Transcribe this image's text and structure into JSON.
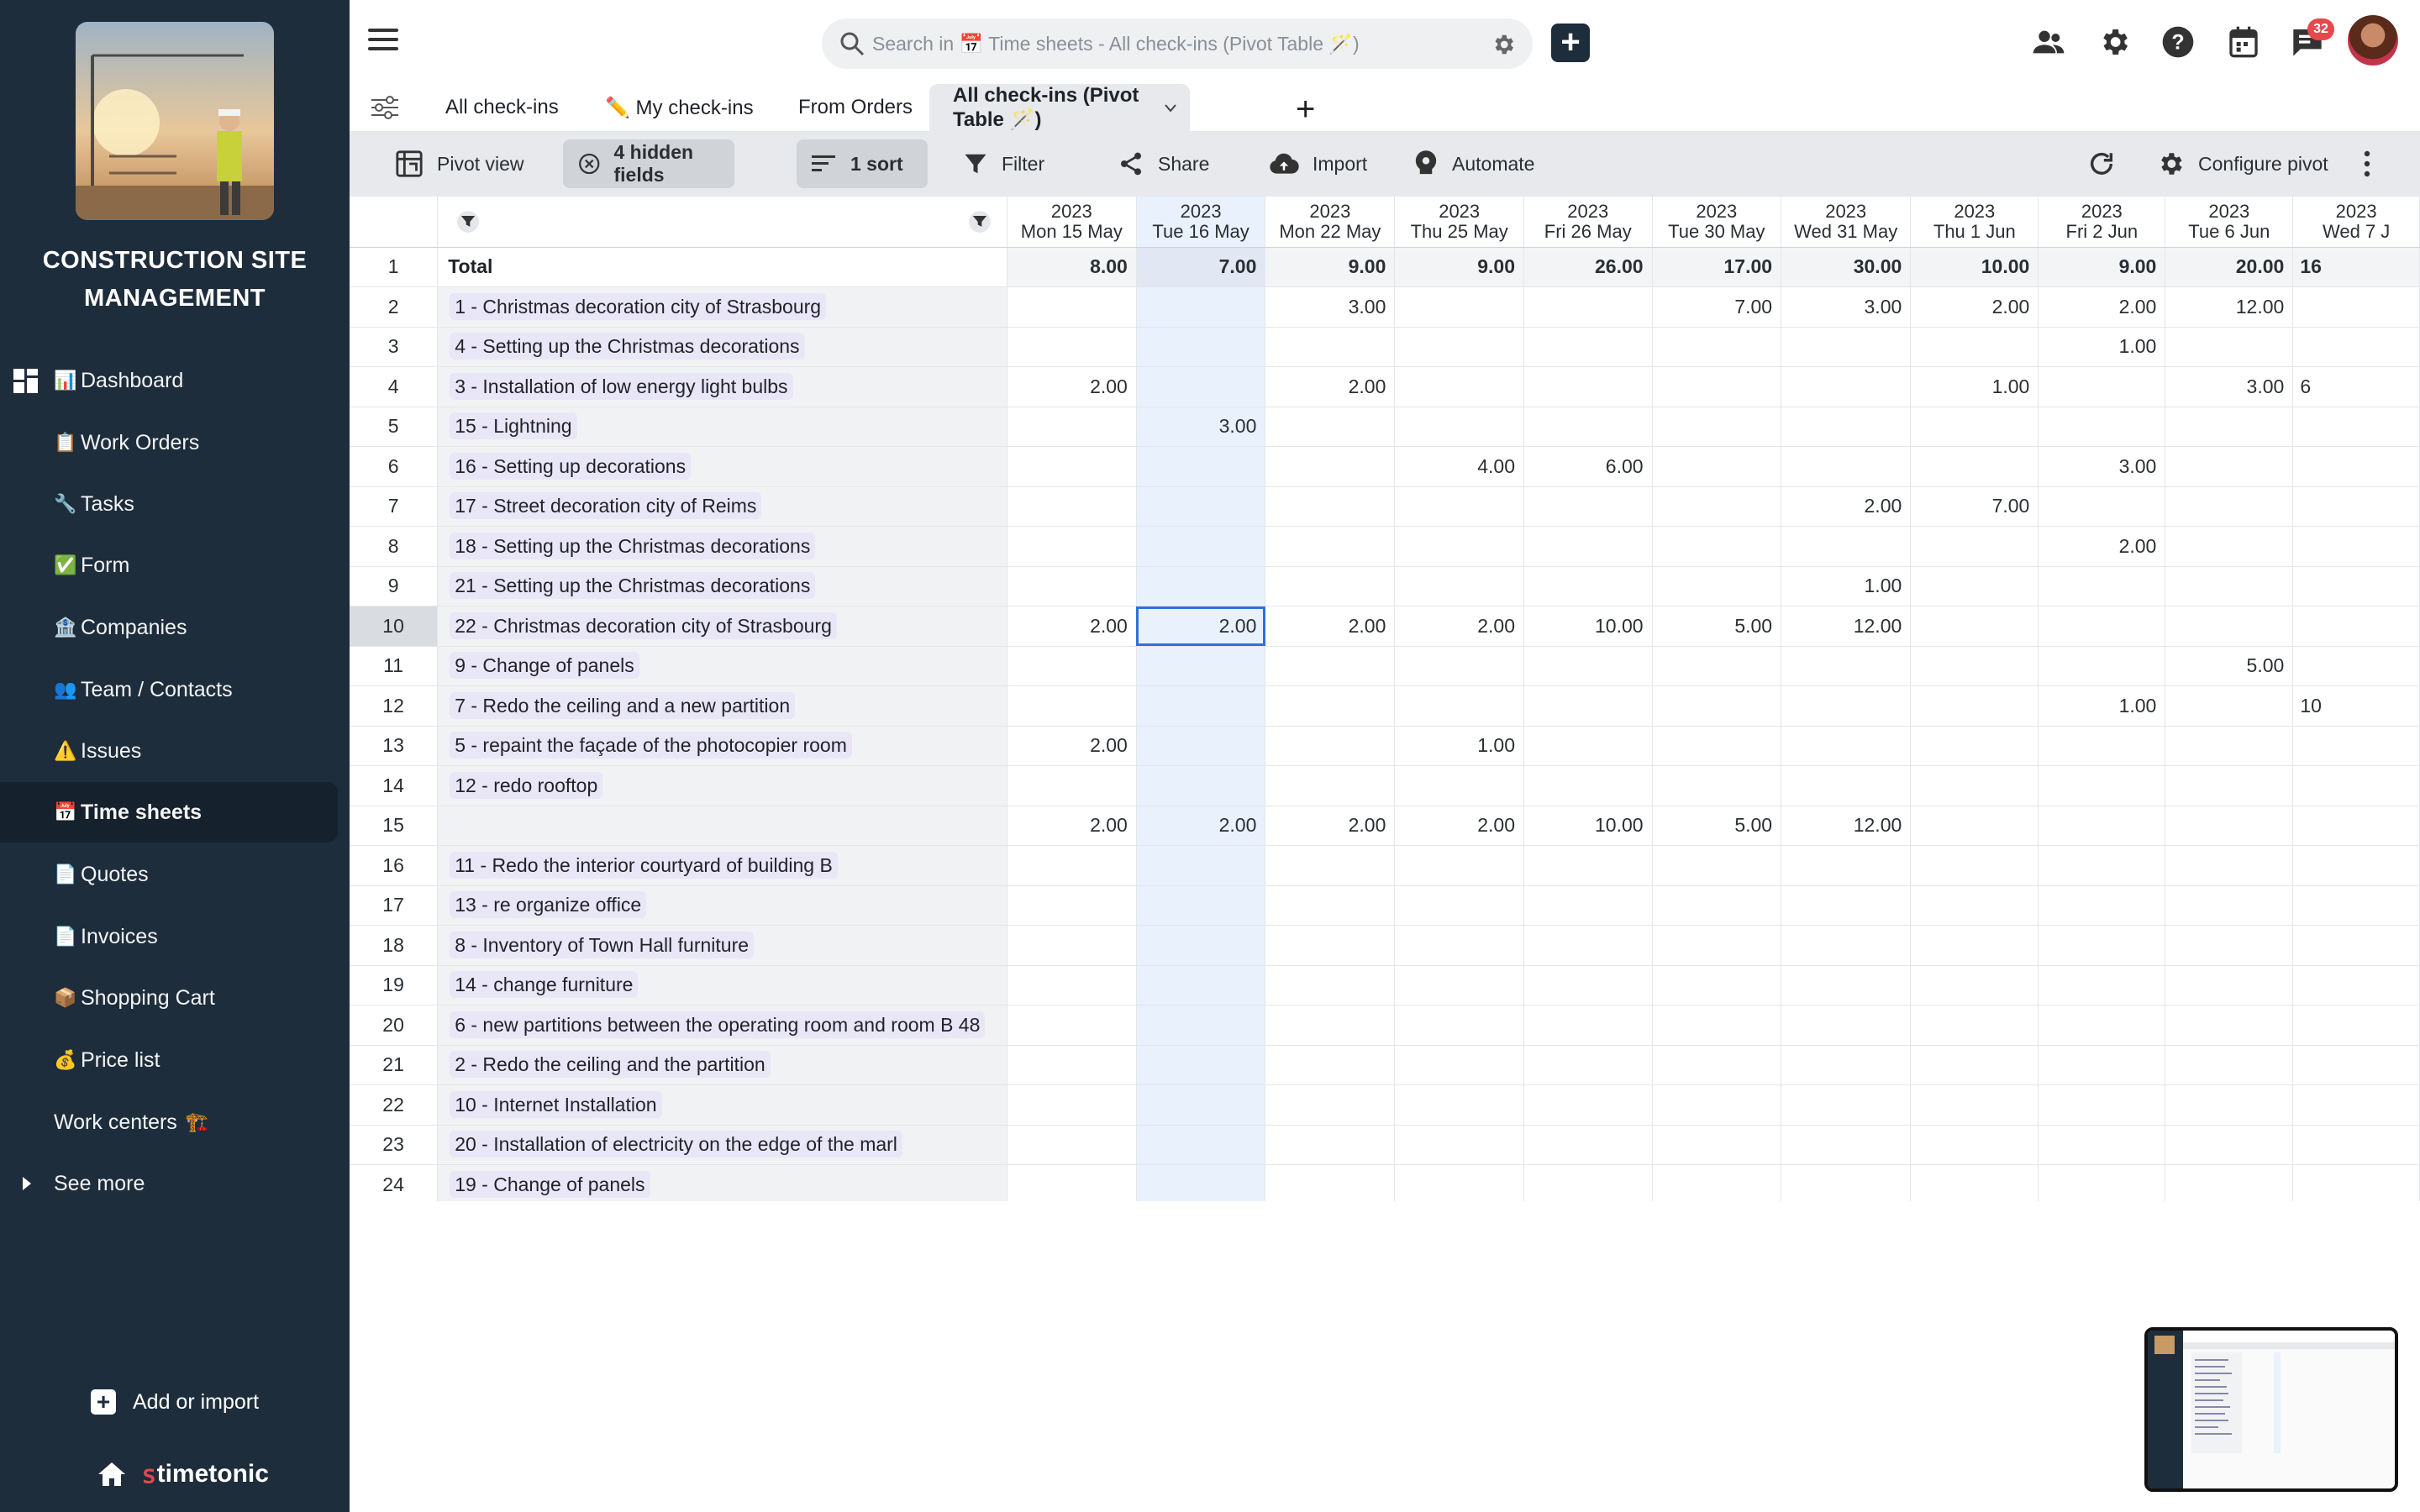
{
  "sidebar": {
    "title_line1": "CONSTRUCTION SITE",
    "title_line2": "MANAGEMENT",
    "items": [
      {
        "emoji": "📊",
        "label": "Dashboard"
      },
      {
        "emoji": "📋",
        "label": "Work Orders"
      },
      {
        "emoji": "🔧",
        "label": "Tasks"
      },
      {
        "emoji": "✅",
        "label": "Form"
      },
      {
        "emoji": "🏦",
        "label": "Companies"
      },
      {
        "emoji": "👥",
        "label": "Team / Contacts"
      },
      {
        "emoji": "⚠️",
        "label": "Issues"
      },
      {
        "emoji": "📅",
        "label": "Time sheets"
      },
      {
        "emoji": "📄",
        "label": "Quotes"
      },
      {
        "emoji": "📄",
        "label": "Invoices"
      },
      {
        "emoji": "📦",
        "label": "Shopping Cart"
      },
      {
        "emoji": "💰",
        "label": "Price list"
      },
      {
        "emoji": "🏗️",
        "label": "Work centers"
      },
      {
        "emoji": "",
        "label": "See more"
      }
    ],
    "add_label": "Add or import",
    "brand": "timetonic"
  },
  "topbar": {
    "search_placeholder": "Search in 📅 Time sheets - All check-ins (Pivot Table 🪄)",
    "notification_count": "32"
  },
  "tabs": [
    {
      "label": "All check-ins"
    },
    {
      "label": "✏️ My check-ins"
    },
    {
      "label": "From Orders"
    },
    {
      "label": "All check-ins (Pivot Table 🪄)"
    }
  ],
  "toolbar": {
    "pivot_view": "Pivot view",
    "hidden_fields": "4 hidden fields",
    "sort": "1 sort",
    "filter": "Filter",
    "share": "Share",
    "import": "Import",
    "automate": "Automate",
    "configure_pivot": "Configure pivot"
  },
  "grid": {
    "columns": [
      {
        "year": "2023",
        "day": "Mon 15 May"
      },
      {
        "year": "2023",
        "day": "Tue 16 May"
      },
      {
        "year": "2023",
        "day": "Mon 22 May"
      },
      {
        "year": "2023",
        "day": "Thu 25 May"
      },
      {
        "year": "2023",
        "day": "Fri 26 May"
      },
      {
        "year": "2023",
        "day": "Tue 30 May"
      },
      {
        "year": "2023",
        "day": "Wed 31 May"
      },
      {
        "year": "2023",
        "day": "Thu 1 Jun"
      },
      {
        "year": "2023",
        "day": "Fri 2 Jun"
      },
      {
        "year": "2023",
        "day": "Tue 6 Jun"
      },
      {
        "year": "2023",
        "day": "Wed 7 J"
      }
    ],
    "rows": [
      {
        "n": "1",
        "label": "Total",
        "values": [
          "8.00",
          "7.00",
          "9.00",
          "9.00",
          "26.00",
          "17.00",
          "30.00",
          "10.00",
          "9.00",
          "20.00",
          "16"
        ]
      },
      {
        "n": "2",
        "label": "1 - Christmas decoration city of Strasbourg",
        "values": [
          "",
          "",
          "3.00",
          "",
          "",
          "7.00",
          "3.00",
          "2.00",
          "2.00",
          "12.00",
          ""
        ]
      },
      {
        "n": "3",
        "label": "4 - Setting up the Christmas decorations",
        "values": [
          "",
          "",
          "",
          "",
          "",
          "",
          "",
          "",
          "1.00",
          "",
          ""
        ]
      },
      {
        "n": "4",
        "label": "3 - Installation of low energy light bulbs",
        "values": [
          "2.00",
          "",
          "2.00",
          "",
          "",
          "",
          "",
          "1.00",
          "",
          "3.00",
          "6"
        ]
      },
      {
        "n": "5",
        "label": "15 - Lightning",
        "values": [
          "",
          "3.00",
          "",
          "",
          "",
          "",
          "",
          "",
          "",
          "",
          ""
        ]
      },
      {
        "n": "6",
        "label": "16 - Setting up decorations",
        "values": [
          "",
          "",
          "",
          "4.00",
          "6.00",
          "",
          "",
          "",
          "3.00",
          "",
          ""
        ]
      },
      {
        "n": "7",
        "label": "17 - Street decoration city of Reims",
        "values": [
          "",
          "",
          "",
          "",
          "",
          "",
          "2.00",
          "7.00",
          "",
          "",
          ""
        ]
      },
      {
        "n": "8",
        "label": "18 - Setting up the Christmas decorations",
        "values": [
          "",
          "",
          "",
          "",
          "",
          "",
          "",
          "",
          "2.00",
          "",
          ""
        ]
      },
      {
        "n": "9",
        "label": "21 - Setting up the Christmas decorations",
        "values": [
          "",
          "",
          "",
          "",
          "",
          "",
          "1.00",
          "",
          "",
          "",
          ""
        ]
      },
      {
        "n": "10",
        "label": "22 - Christmas decoration city of Strasbourg",
        "values": [
          "2.00",
          "2.00",
          "2.00",
          "2.00",
          "10.00",
          "5.00",
          "12.00",
          "",
          "",
          "",
          ""
        ]
      },
      {
        "n": "11",
        "label": "9 - Change of panels",
        "values": [
          "",
          "",
          "",
          "",
          "",
          "",
          "",
          "",
          "",
          "5.00",
          ""
        ]
      },
      {
        "n": "12",
        "label": "7 - Redo the ceiling and a new partition",
        "values": [
          "",
          "",
          "",
          "",
          "",
          "",
          "",
          "",
          "1.00",
          "",
          "10"
        ]
      },
      {
        "n": "13",
        "label": "5 - repaint the façade of the photocopier room",
        "values": [
          "2.00",
          "",
          "",
          "1.00",
          "",
          "",
          "",
          "",
          "",
          "",
          ""
        ]
      },
      {
        "n": "14",
        "label": "12 - redo rooftop",
        "values": [
          "",
          "",
          "",
          "",
          "",
          "",
          "",
          "",
          "",
          "",
          ""
        ]
      },
      {
        "n": "15",
        "label": "",
        "values": [
          "2.00",
          "2.00",
          "2.00",
          "2.00",
          "10.00",
          "5.00",
          "12.00",
          "",
          "",
          "",
          ""
        ]
      },
      {
        "n": "16",
        "label": "11 - Redo the interior courtyard of building B",
        "values": [
          "",
          "",
          "",
          "",
          "",
          "",
          "",
          "",
          "",
          "",
          ""
        ]
      },
      {
        "n": "17",
        "label": "13 - re organize office",
        "values": [
          "",
          "",
          "",
          "",
          "",
          "",
          "",
          "",
          "",
          "",
          ""
        ]
      },
      {
        "n": "18",
        "label": "8 - Inventory of Town Hall furniture",
        "values": [
          "",
          "",
          "",
          "",
          "",
          "",
          "",
          "",
          "",
          "",
          ""
        ]
      },
      {
        "n": "19",
        "label": "14 - change furniture",
        "values": [
          "",
          "",
          "",
          "",
          "",
          "",
          "",
          "",
          "",
          "",
          ""
        ]
      },
      {
        "n": "20",
        "label": "6 - new partitions between the operating room and room B 48",
        "values": [
          "",
          "",
          "",
          "",
          "",
          "",
          "",
          "",
          "",
          "",
          ""
        ]
      },
      {
        "n": "21",
        "label": "2 - Redo the ceiling and the partition",
        "values": [
          "",
          "",
          "",
          "",
          "",
          "",
          "",
          "",
          "",
          "",
          ""
        ]
      },
      {
        "n": "22",
        "label": "10 - Internet Installation",
        "values": [
          "",
          "",
          "",
          "",
          "",
          "",
          "",
          "",
          "",
          "",
          ""
        ]
      },
      {
        "n": "23",
        "label": "20 - Installation of electricity on the edge of the marl",
        "values": [
          "",
          "",
          "",
          "",
          "",
          "",
          "",
          "",
          "",
          "",
          ""
        ]
      },
      {
        "n": "24",
        "label": "19 - Change of panels",
        "values": [
          "",
          "",
          "",
          "",
          "",
          "",
          "",
          "",
          "",
          "",
          ""
        ]
      }
    ]
  }
}
